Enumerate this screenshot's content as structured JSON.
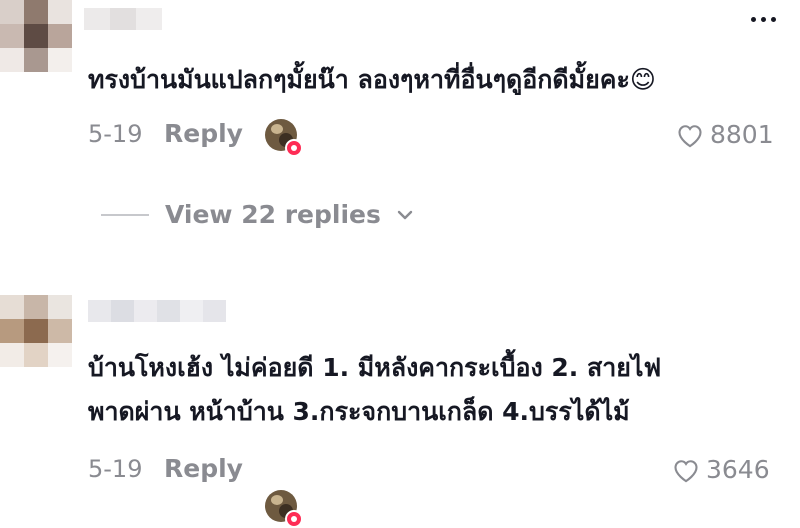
{
  "comments": [
    {
      "text_lines": [
        "ทรงบ้านมันแปลกๆมั้ยน๊า ลองๆหาที่อื่นๆดูอีกดีมั้ยคะ"
      ],
      "emoji": "😊",
      "date": "5-19",
      "reply_label": "Reply",
      "like_count": "8801",
      "view_replies_label": "View 22 replies"
    },
    {
      "text_lines": [
        "บ้านโหงเฮ้ง ไม่ค่อยดี 1. มีหลังคากระเบื้อง 2. สายไฟ",
        "พาดผ่าน หน้าบ้าน 3.กระจกบานเกล็ด 4.บรรได้ไม้"
      ],
      "date": "5-19",
      "reply_label": "Reply",
      "like_count": "3646"
    }
  ],
  "icons": {
    "more": "more-options-icon",
    "heart": "heart-outline-icon",
    "chevron": "chevron-down-icon"
  },
  "colors": {
    "primary_text": "#161823",
    "secondary_text": "#8a8b91",
    "accent": "#fe2c55"
  }
}
